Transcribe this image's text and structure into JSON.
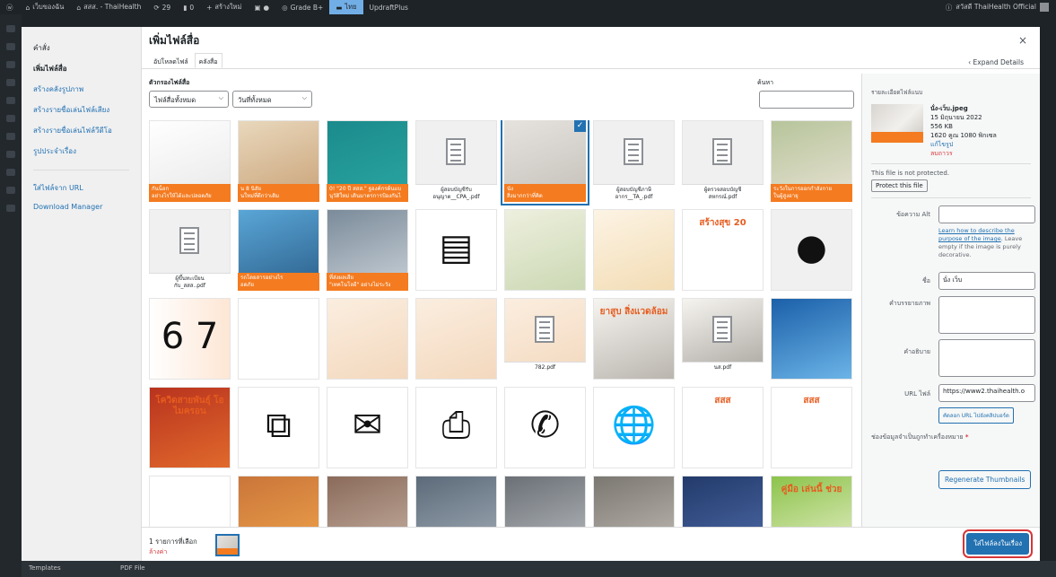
{
  "admin_bar": {
    "site_name": "เว็บของฉัน",
    "site_title": "สสส. - ThaiHealth",
    "updates": "29",
    "comments": "0",
    "new": "สร้างใหม่",
    "grade": "Grade B+",
    "lang": "ไทย",
    "plugin": "UpdraftPlus",
    "greeting": "สวัสดี ThaiHealth Official"
  },
  "behind": {
    "left": "Templates",
    "mid": "PDF File"
  },
  "sidebar_menu": {
    "actions_label": "คำสั่ง",
    "items": [
      {
        "label": "เพิ่มไฟล์สื่อ"
      },
      {
        "label": "สร้างคลังรูปภาพ"
      },
      {
        "label": "สร้างรายชื่อเล่นไฟล์เสียง"
      },
      {
        "label": "สร้างรายชื่อเล่นไฟล์วีดีโอ"
      },
      {
        "label": "รูปประจำเรื่อง"
      }
    ],
    "items2": [
      {
        "label": "ใส่ไฟล์จาก URL"
      },
      {
        "label": "Download Manager"
      }
    ]
  },
  "modal": {
    "title": "เพิ่มไฟล์สื่อ",
    "close": "×",
    "tabs": [
      "อัปโหลดไฟล์",
      "คลังสื่อ"
    ],
    "expand": "‹ Expand Details",
    "filter_label": "ตัวกรองไฟล์สื่อ",
    "filter_type": "ไฟล์สื่อทั้งหมด",
    "filter_date": "วันที่ทั้งหมด",
    "search_label": "ค้นหา"
  },
  "tiles": [
    {
      "caption": "กันน็อก\nอย่างไรให้ได้และปลอดภัย"
    },
    {
      "caption": "น 8 นิสัย\nนใหม่ที่ดีกว่าเดิม"
    },
    {
      "caption": "0! \"20 ปี สสส.\" ฐองค์กรต้นแบ\nนุวัติใหม่ เดินมาตรการป้องกันไ"
    },
    {
      "file": "ผู้สอบบัญชีรับ\nอนุญาต__CPA_.pdf"
    },
    {
      "caption": "นัง\nสิ่งมากกว่าที่คิด"
    },
    {
      "file": "ผู้สอบบัญชีภาษี\nอากร__TA_.pdf"
    },
    {
      "file": "ผู้ตรวจสอบบัญชี\nสหกรณ์.pdf"
    },
    {
      "caption": "ระวังในการออกกำลังกาย\nในผู้สูงอายุ"
    },
    {
      "file": "ผู้ขึ้นทะเบียน\nกับ_สสส..pdf"
    },
    {
      "caption": "รถโดยสารอย่างไร\nอดภัย"
    },
    {
      "caption": "ที่ส่งผลเสีย\n\"เทคโนโลยี\" อย่างไม่ระวัง"
    },
    {},
    {},
    {},
    {
      "text": "สร้างสุข 20"
    },
    {},
    {},
    {},
    {},
    {},
    {
      "file": "782.pdf"
    },
    {
      "text": "ยาสูบ สิ่งแวดล้อม"
    },
    {
      "file": "นส.pdf"
    },
    {},
    {
      "text": "โควิดสายพันธุ์ โอไมครอน"
    },
    {},
    {},
    {},
    {},
    {},
    {
      "text": "สสส"
    },
    {
      "text": "สสส"
    },
    {},
    {},
    {},
    {},
    {},
    {},
    {},
    {
      "text": "คู่มือ เล่นนี้ ช่วย"
    }
  ],
  "details": {
    "heading": "รายละเอียดไฟล์แนบ",
    "filename": "นั่ง-เว็บ.jpeg",
    "date": "15 มิถุนายน 2022",
    "size": "556 KB",
    "dims": "1620 คูณ 1080 พิกเซล",
    "edit": "แก้ไขรูป",
    "delete": "ลบถาวร",
    "protect_note": "This file is not protected.",
    "protect_btn": "Protect this file",
    "alt_label": "ข้อความ Alt",
    "alt_help_link": "Learn how to describe the purpose of the image",
    "alt_help_rest": ". Leave empty if the image is purely decorative.",
    "title_label": "ชื่อ",
    "title_value": "นั่ง เว็บ",
    "caption_label": "คำบรรยายภาพ",
    "desc_label": "คำอธิบาย",
    "url_label": "URL ไฟล์",
    "url_value": "https://www2.thaihealth.o",
    "copy_btn": "คัดลอก URL ไปยังคลิปบอร์ด",
    "required": "ช่องข้อมูลจำเป็นถูกทำเครื่องหมาย",
    "regen": "Regenerate Thumbnails"
  },
  "toolbar": {
    "count": "1 รายการที่เลือก",
    "clear": "ล้างค่า",
    "insert": "ใส่ไฟล์ลงในเรื่อง"
  },
  "colors": {
    "accent": "#2271b1",
    "orange": "#f47b20",
    "danger": "#d63638"
  }
}
